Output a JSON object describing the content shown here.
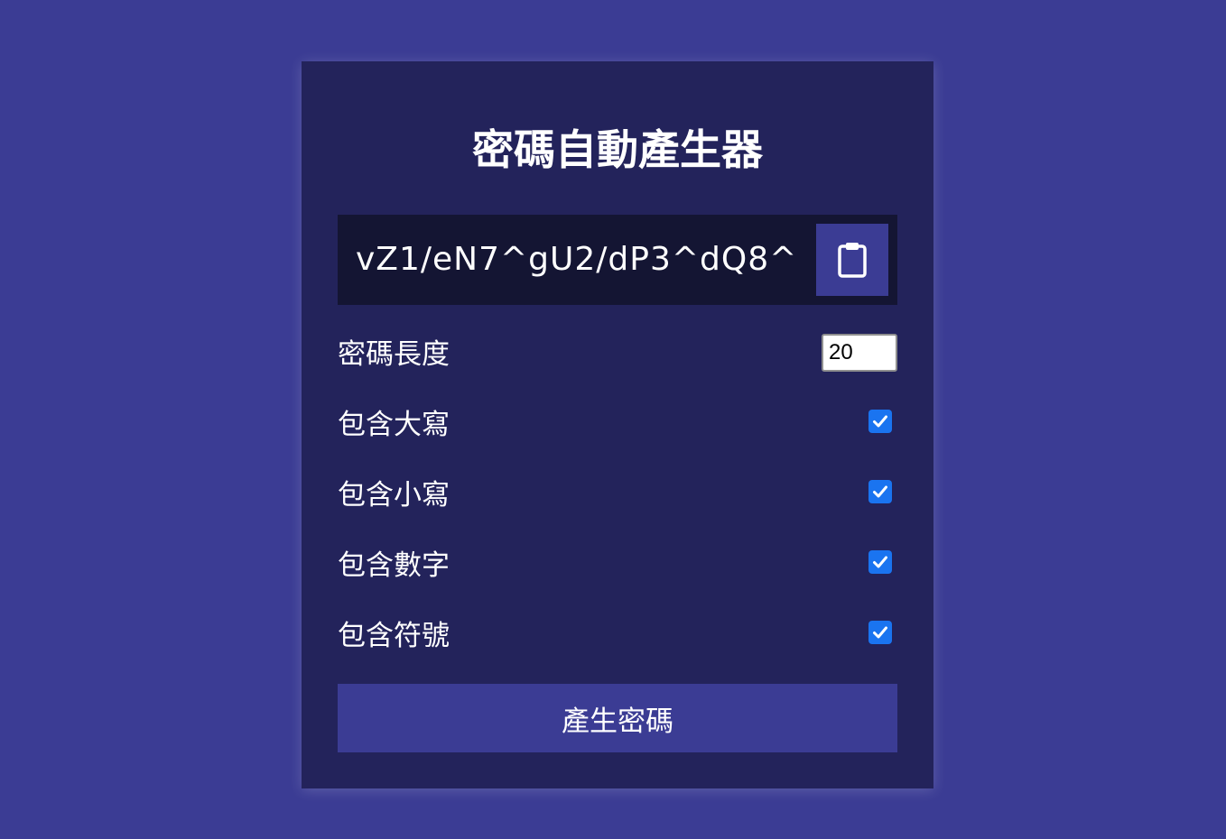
{
  "colors": {
    "page_background": "#3b3c94",
    "card_background": "#23235b",
    "result_background": "#141533",
    "button_background": "#3b3c94",
    "checkbox_accent": "#1a74f0"
  },
  "title": "密碼自動產生器",
  "result": {
    "password": "vZ1/eN7^gU2/dP3^dQ8^",
    "copy_icon": "clipboard-icon"
  },
  "settings": {
    "length": {
      "label": "密碼長度",
      "value": "20"
    },
    "options": [
      {
        "label": "包含大寫",
        "checked": true
      },
      {
        "label": "包含小寫",
        "checked": true
      },
      {
        "label": "包含數字",
        "checked": true
      },
      {
        "label": "包含符號",
        "checked": true
      }
    ]
  },
  "generate_button": "產生密碼"
}
